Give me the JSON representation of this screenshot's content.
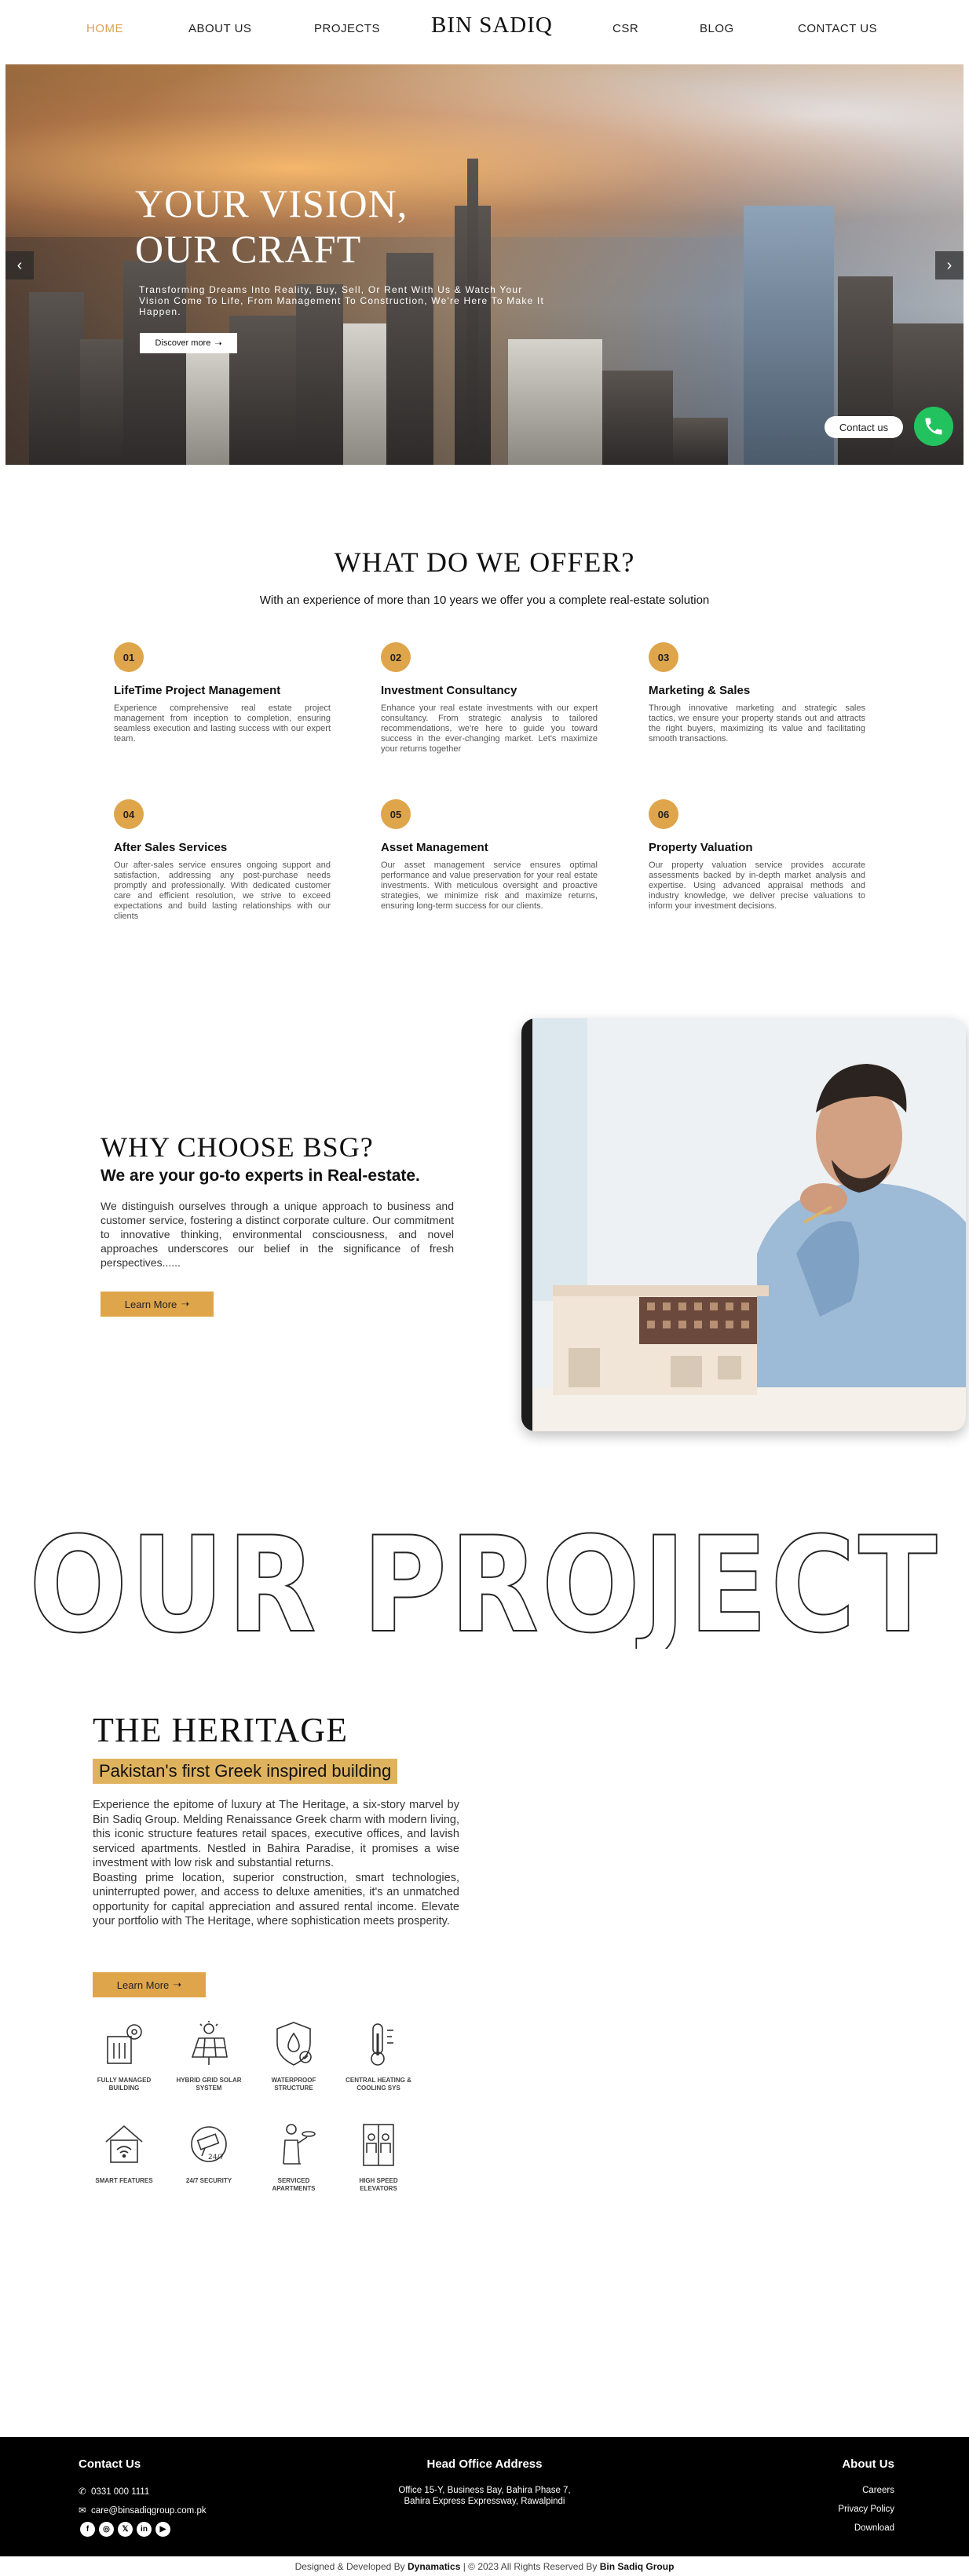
{
  "nav": {
    "home": "HOME",
    "about": "ABOUT US",
    "projects": "PROJECTS",
    "brand": "BIN SADIQ",
    "csr": "CSR",
    "blog": "BLOG",
    "contact": "CONTACT US"
  },
  "hero": {
    "title_line1": "YOUR VISION,",
    "title_line2": "OUR CRAFT",
    "subtitle": "Transforming Dreams Into Reality, Buy, Sell, Or Rent With Us & Watch Your Vision Come To Life, From Management To Construction, We're Here To Make It Happen.",
    "button": "Discover more",
    "contact_pill": "Contact us"
  },
  "offer": {
    "title": "WHAT DO WE OFFER?",
    "subtitle": "With an experience of more than 10 years we offer you a complete real-estate solution",
    "services": [
      {
        "num": "01",
        "title": "LifeTime Project Management",
        "desc": "Experience comprehensive real estate project management from inception to completion, ensuring seamless execution and lasting success with our expert team."
      },
      {
        "num": "02",
        "title": "Investment Consultancy",
        "desc": "Enhance your real estate investments with our expert consultancy. From strategic analysis to tailored recommendations, we're here to guide you toward success in the ever-changing market. Let's maximize your returns together"
      },
      {
        "num": "03",
        "title": "Marketing & Sales",
        "desc": "Through innovative marketing and strategic sales tactics, we ensure your property stands out and attracts the right buyers, maximizing its value and facilitating smooth transactions."
      },
      {
        "num": "04",
        "title": "After Sales Services",
        "desc": "Our after-sales service ensures ongoing support and satisfaction, addressing any post-purchase needs promptly and professionally. With dedicated customer care and efficient resolution, we strive to exceed expectations and build lasting relationships with our clients"
      },
      {
        "num": "05",
        "title": "Asset Management",
        "desc": "Our asset management service ensures optimal performance and value preservation for your real estate investments. With meticulous oversight and proactive strategies, we minimize risk and maximize returns, ensuring long-term success for our clients."
      },
      {
        "num": "06",
        "title": "Property Valuation",
        "desc": "Our property valuation service provides accurate assessments backed by in-depth market analysis and expertise. Using advanced appraisal methods and industry knowledge, we deliver precise valuations to inform your investment decisions."
      }
    ]
  },
  "why": {
    "title": "WHY CHOOSE BSG?",
    "subtitle": "We are your go-to experts in Real-estate.",
    "body": "We distinguish ourselves through a unique approach to business and customer service, fostering a distinct corporate culture. Our commitment to innovative thinking, environmental consciousness, and novel approaches underscores our belief in the significance of fresh perspectives......",
    "button": "Learn More"
  },
  "project": {
    "big_title": "OUR PROJECT",
    "name": "THE HERITAGE",
    "tagline": "Pakistan's first Greek inspired building",
    "body1": "Experience the epitome of luxury at The Heritage, a six-story marvel by Bin Sadiq Group. Melding Renaissance Greek charm with modern living, this iconic structure features retail spaces, executive offices, and lavish serviced apartments. Nestled in Bahira Paradise, it promises a wise investment with low risk and substantial returns.",
    "body2": "Boasting prime location, superior construction, smart technologies, uninterrupted power, and access to deluxe amenities, it's an unmatched opportunity for capital appreciation and assured rental income. Elevate your portfolio with The Heritage, where sophistication meets prosperity.",
    "button": "Learn More",
    "features": [
      {
        "label": "FULLY MANAGED BUILDING",
        "icon": "managed-building-icon"
      },
      {
        "label": "HYBRID GRID SOLAR SYSTEM",
        "icon": "solar-panel-icon"
      },
      {
        "label": "WATERPROOF STRUCTURE",
        "icon": "waterproof-shield-icon"
      },
      {
        "label": "CENTRAL HEATING & COOLING SYS",
        "icon": "thermometer-icon"
      },
      {
        "label": "SMART FEATURES",
        "icon": "smart-home-icon"
      },
      {
        "label": "24/7 SECURITY",
        "icon": "security-camera-icon"
      },
      {
        "label": "SERVICED APARTMENTS",
        "icon": "service-staff-icon"
      },
      {
        "label": "HIGH SPEED ELEVATORS",
        "icon": "elevator-icon"
      }
    ]
  },
  "footer": {
    "contact_heading": "Contact Us",
    "phone": "0331 000 1111",
    "email": "care@binsadiqgroup.com.pk",
    "office_heading": "Head Office Address",
    "address1": "Office 15-Y, Business Bay, Bahira Phase 7,",
    "address2": "Bahira Express Expressway, Rawalpindi",
    "about_heading": "About Us",
    "links": [
      "Careers",
      "Privacy Policy",
      "Download"
    ],
    "social": [
      "facebook-icon",
      "instagram-icon",
      "x-icon",
      "linkedin-icon",
      "youtube-icon"
    ],
    "credits_prefix": "Designed & Developed By ",
    "credits_dev": "Dynamatics",
    "credits_mid": " | © 2023 All Rights Reserved By ",
    "credits_owner": "Bin Sadiq Group"
  },
  "colors": {
    "accent": "#dfa54b",
    "nav_active": "#d8a356",
    "whatsapp": "#22c35e",
    "footer_bg": "#000000"
  }
}
